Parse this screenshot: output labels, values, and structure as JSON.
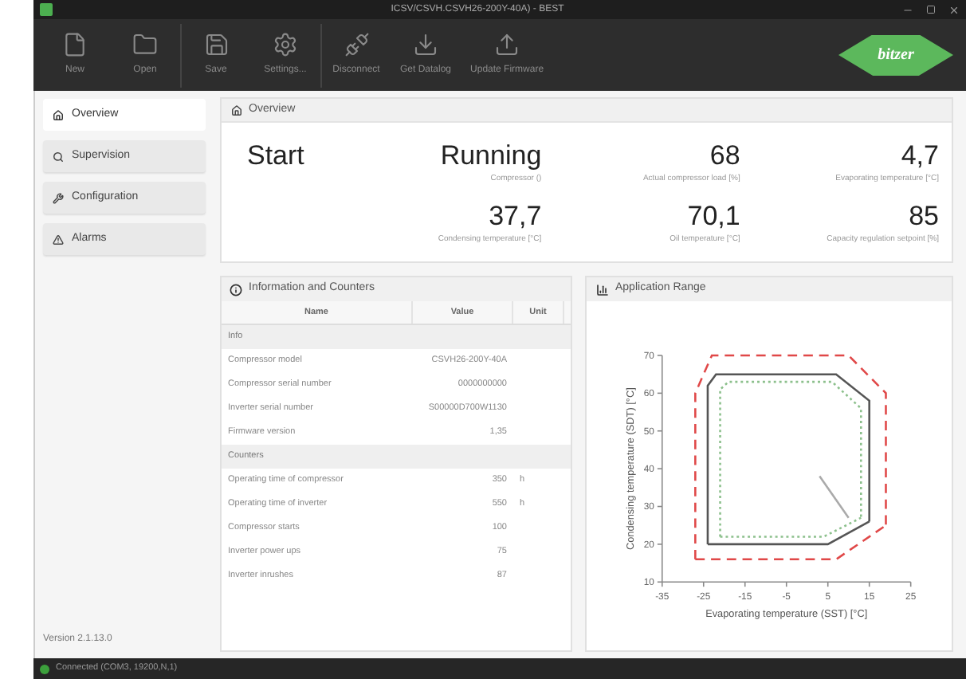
{
  "window": {
    "title": "ICSV/CSVH.CSVH26-200Y-40A) - BEST"
  },
  "toolbar": [
    {
      "label": "New"
    },
    {
      "label": "Open"
    },
    {
      "label": "Save"
    },
    {
      "label": "Settings..."
    },
    {
      "label": "Disconnect"
    },
    {
      "label": "Get Datalog"
    },
    {
      "label": "Update Firmware"
    }
  ],
  "logo": "bitzer",
  "sidebar": {
    "items": [
      {
        "label": "Overview",
        "selected": true
      },
      {
        "label": "Supervision",
        "selected": false
      },
      {
        "label": "Configuration",
        "selected": false
      },
      {
        "label": "Alarms",
        "selected": false
      }
    ],
    "version": "Version 2.1.13.0"
  },
  "overview": {
    "title": "Overview",
    "state": "Start",
    "readings": [
      {
        "value": "Running",
        "label": "Compressor ()"
      },
      {
        "value": "68",
        "label": "Actual compressor load [%]"
      },
      {
        "value": "4,7",
        "label": "Evaporating temperature [°C]"
      },
      {
        "value": "37,7",
        "label": "Condensing temperature [°C]"
      },
      {
        "value": "70,1",
        "label": "Oil temperature [°C]"
      },
      {
        "value": "85",
        "label": "Capacity regulation setpoint [%]"
      }
    ]
  },
  "info": {
    "title": "Information and Counters",
    "columns": [
      "Name",
      "Value",
      "Unit"
    ],
    "rows": [
      {
        "kind": "group",
        "name": "Info"
      },
      {
        "kind": "row",
        "name": "Compressor model",
        "value": "CSVH26-200Y-40A"
      },
      {
        "kind": "row",
        "name": "Compressor serial number",
        "value": "0000000000"
      },
      {
        "kind": "row",
        "name": "Inverter serial number",
        "value": "S00000D700W1130"
      },
      {
        "kind": "row",
        "name": "Firmware version",
        "value": "1,35"
      },
      {
        "kind": "group",
        "name": "Counters"
      },
      {
        "kind": "row",
        "name": "Operating time of compressor",
        "value": "350",
        "unit": "h"
      },
      {
        "kind": "row",
        "name": "Operating time of inverter",
        "value": "550",
        "unit": "h"
      },
      {
        "kind": "row",
        "name": "Compressor starts",
        "value": "100"
      },
      {
        "kind": "row",
        "name": "Inverter power ups",
        "value": "75"
      },
      {
        "kind": "row",
        "name": "Inverter inrushes",
        "value": "87"
      }
    ]
  },
  "application_range": {
    "title": "Application Range",
    "chart_data": {
      "type": "line",
      "xlabel": "Evaporating temperature (SST) [°C]",
      "ylabel": "Condensing temperature (SDT) [°C]",
      "xlim": [
        -35,
        25
      ],
      "ylim": [
        10,
        70
      ],
      "xticks": [
        -35,
        -25,
        -15,
        -5,
        5,
        15,
        25
      ],
      "yticks": [
        10,
        20,
        30,
        40,
        50,
        60,
        70
      ],
      "series": [
        {
          "color": "#e04848",
          "line_style": "dashed",
          "x": [
            -27,
            -27,
            -23,
            10,
            19,
            19
          ],
          "values": [
            16,
            60,
            70,
            70,
            60,
            25
          ]
        },
        {
          "color": "#e04848",
          "line_style": "dashed",
          "x": [
            -27,
            7,
            19
          ],
          "values": [
            16,
            16,
            25
          ]
        },
        {
          "color": "#555555",
          "line_style": "solid",
          "x": [
            -24,
            -24,
            -22,
            7,
            15,
            15
          ],
          "values": [
            20,
            62,
            65,
            65,
            58,
            26
          ]
        },
        {
          "color": "#555555",
          "line_style": "solid",
          "x": [
            -24,
            5,
            15
          ],
          "values": [
            20,
            20,
            26
          ]
        },
        {
          "color": "#8cc08c",
          "line_style": "dotted",
          "x": [
            -21,
            -21,
            -19,
            6,
            13,
            13
          ],
          "values": [
            22,
            61,
            63,
            63,
            56,
            27
          ]
        },
        {
          "color": "#8cc08c",
          "line_style": "dotted",
          "x": [
            -21,
            4,
            13
          ],
          "values": [
            22,
            22,
            27
          ]
        },
        {
          "color": "#aaaaaa",
          "line_style": "solid",
          "x": [
            3,
            10
          ],
          "values": [
            38,
            27
          ]
        }
      ]
    }
  },
  "status_bar": "Connected (COM3, 19200,N,1)"
}
